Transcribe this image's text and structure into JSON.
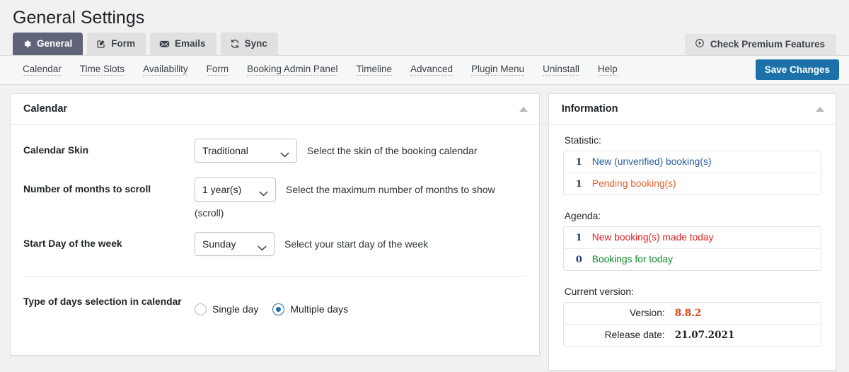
{
  "page": {
    "title": "General Settings"
  },
  "tabs": [
    {
      "label": "General",
      "icon": "gear-icon",
      "active": true
    },
    {
      "label": "Form",
      "icon": "edit-square-icon",
      "active": false
    },
    {
      "label": "Emails",
      "icon": "envelope-icon",
      "active": false
    },
    {
      "label": "Sync",
      "icon": "sync-icon",
      "active": false
    }
  ],
  "premium": {
    "label": "Check Premium Features",
    "icon": "clock-circle-icon"
  },
  "subnav": {
    "links": [
      "Calendar",
      "Time Slots",
      "Availability",
      "Form",
      "Booking Admin Panel",
      "Timeline",
      "Advanced",
      "Plugin Menu",
      "Uninstall",
      "Help"
    ],
    "save_label": "Save Changes"
  },
  "calendar_panel": {
    "title": "Calendar",
    "rows": [
      {
        "label": "Calendar Skin",
        "value": "Traditional",
        "hint": "Select the skin of the booking calendar",
        "note": ""
      },
      {
        "label": "Number of months to scroll",
        "value": "1 year(s)",
        "hint": "Select the maximum number of months to show",
        "note": "(scroll)"
      },
      {
        "label": "Start Day of the week",
        "value": "Sunday",
        "hint": "Select your start day of the week",
        "note": ""
      }
    ],
    "days_selection": {
      "label": "Type of days selection in calendar",
      "options": [
        {
          "label": "Single day",
          "checked": false
        },
        {
          "label": "Multiple days",
          "checked": true
        }
      ]
    }
  },
  "information_panel": {
    "title": "Information",
    "statistic_heading": "Statistic:",
    "statistic": [
      {
        "count": "1",
        "label": "New (unverified) booking(s)",
        "color": "#2a5d9e"
      },
      {
        "count": "1",
        "label": "Pending booking(s)",
        "color": "#e2622b"
      }
    ],
    "agenda_heading": "Agenda:",
    "agenda": [
      {
        "count": "1",
        "label": "New booking(s) made today",
        "color": "#e02121"
      },
      {
        "count": "0",
        "label": "Bookings for today",
        "color": "#0f8b2c"
      }
    ],
    "version_heading": "Current version:",
    "version": [
      {
        "key": "Version:",
        "value": "8.8.2",
        "color": "#e2401c"
      },
      {
        "key": "Release date:",
        "value": "21.07.2021",
        "color": "#1d2327"
      }
    ]
  },
  "colors": {
    "accent_blue": "#1b71a8",
    "active_tab": "#5f6478",
    "radio_blue": "#2271b1",
    "page_bg": "#f1f1f1"
  }
}
